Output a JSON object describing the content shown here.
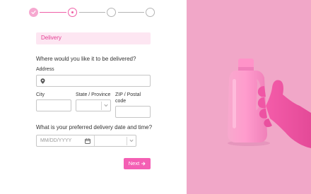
{
  "stepper": {
    "steps": [
      "completed",
      "current",
      "upcoming",
      "upcoming"
    ]
  },
  "form": {
    "section_title": "Delivery",
    "question_address": "Where would you like it to be delivered?",
    "address_label": "Address",
    "address_value": "",
    "city_label": "City",
    "city_value": "",
    "state_label": "State / Province",
    "state_value": "",
    "zip_label": "ZIP / Postal code",
    "zip_value": "",
    "question_datetime": "What is your preferred delivery date and time?",
    "date_placeholder": "MM/DD/YYYY",
    "time_value": "",
    "next_label": "Next"
  },
  "colors": {
    "accent": "#ef5fa7",
    "section_bg": "#fde6f2",
    "photo_bg": "#f1a7c8",
    "button_bg": "#f45fb4"
  },
  "icons": {
    "completed_step": "check-icon",
    "address": "map-pin-icon",
    "date": "calendar-icon",
    "dropdown": "chevron-down-icon",
    "next": "arrow-right-icon"
  },
  "photo": {
    "subject": "pink-gloved hand holding a pink detergent bottle"
  }
}
